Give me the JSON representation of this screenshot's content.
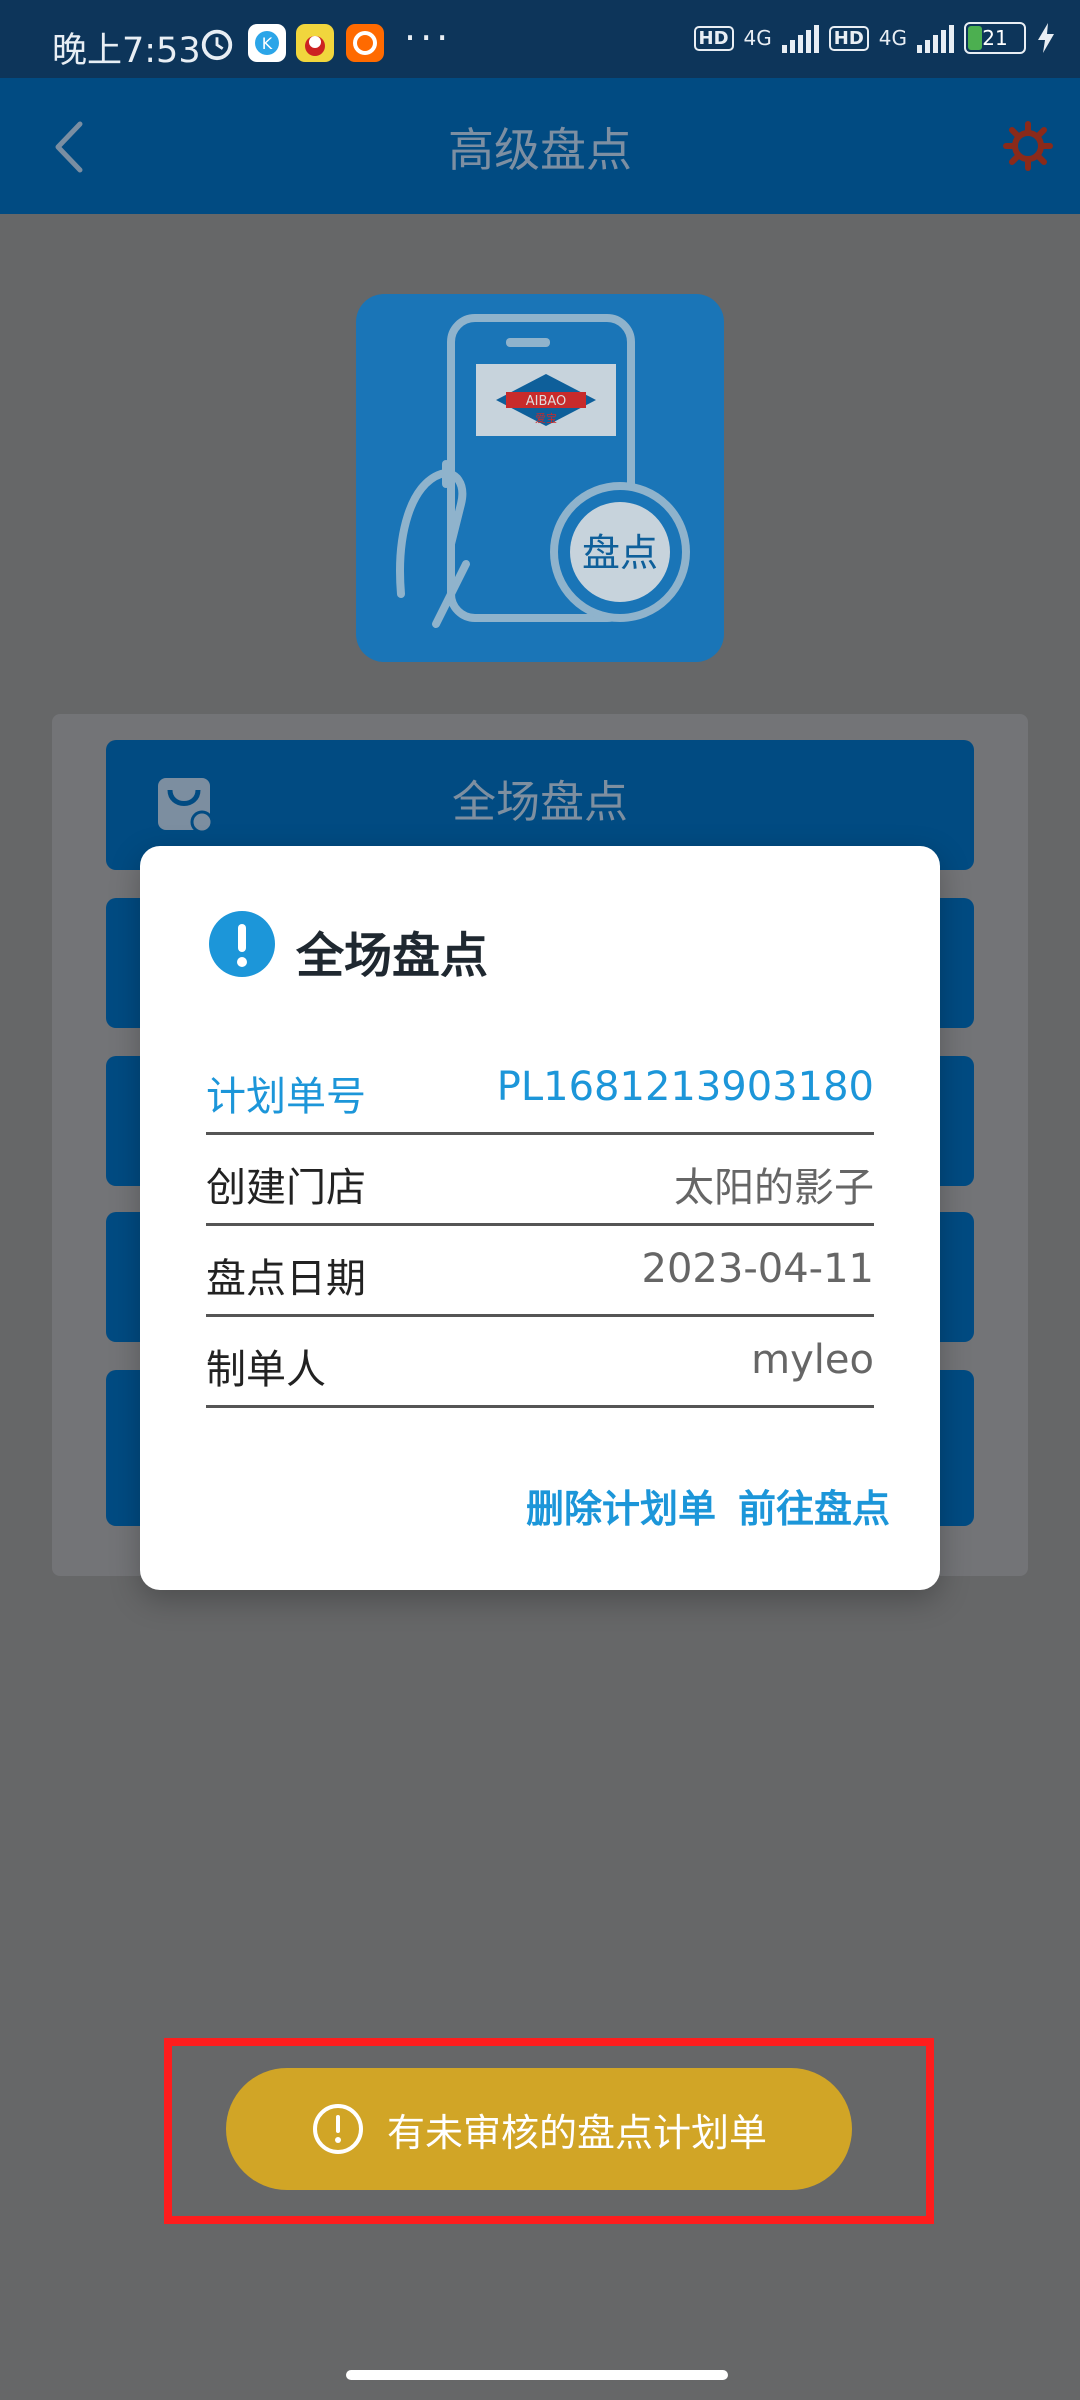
{
  "status_bar": {
    "time": "晚上7:53",
    "hd1": "HD",
    "net1": "4G",
    "hd2": "HD",
    "net2": "4G",
    "battery": "21",
    "app_icons": [
      "alarm-icon",
      "k-app-icon",
      "avatar-app-icon",
      "taobao-icon"
    ],
    "more": "···"
  },
  "app_bar": {
    "title": "高级盘点"
  },
  "hero": {
    "brand": "AIBAO",
    "brand_sub": "爱宝",
    "badge": "盘点"
  },
  "menu": {
    "items": [
      {
        "label": "全场盘点"
      }
    ]
  },
  "dialog": {
    "title": "全场盘点",
    "rows": [
      {
        "label": "计划单号",
        "value": "PL1681213903180"
      },
      {
        "label": "创建门店",
        "value": "太阳的影子"
      },
      {
        "label": "盘点日期",
        "value": "2023-04-11"
      },
      {
        "label": "制单人",
        "value": "myleo"
      }
    ],
    "actions": {
      "delete": "删除计划单",
      "go": "前往盘点"
    }
  },
  "toast": {
    "text": "有未审核的盘点计划单"
  },
  "colors": {
    "accent_blue": "#1c96d9",
    "toast_gold": "#d1a526",
    "highlight_red": "#ff1d1d"
  }
}
